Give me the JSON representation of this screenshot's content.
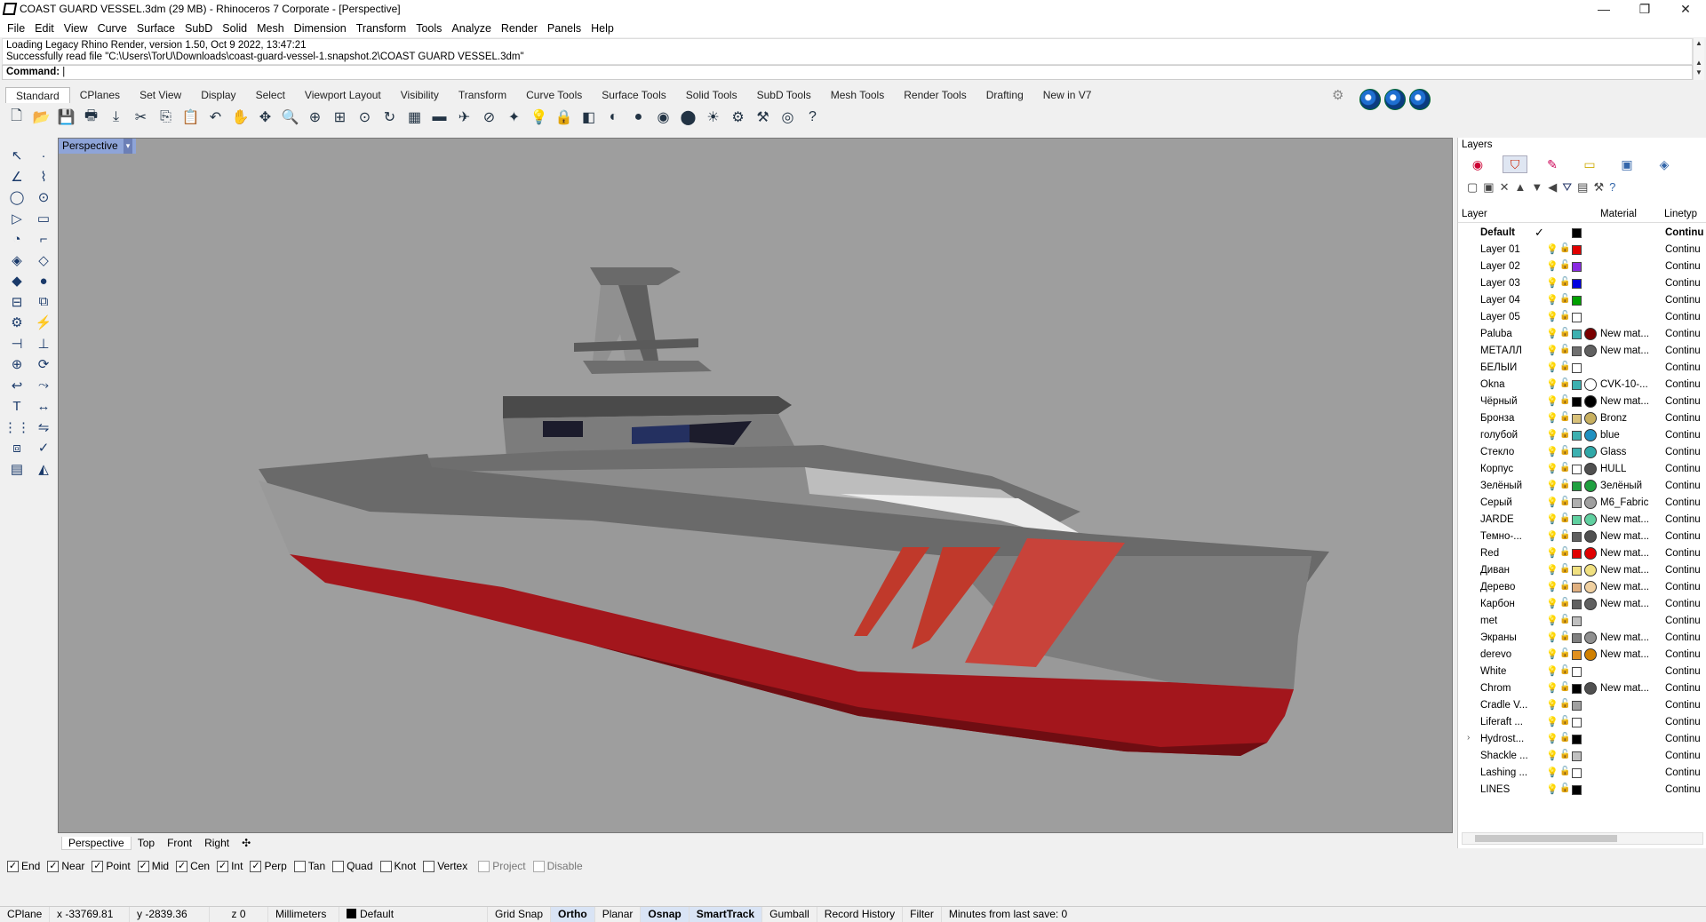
{
  "window": {
    "title": "COAST GUARD VESSEL.3dm (29 MB) - Rhinoceros 7 Corporate - [Perspective]",
    "minimize": "—",
    "maximize": "❐",
    "close": "✕"
  },
  "menu": [
    "File",
    "Edit",
    "View",
    "Curve",
    "Surface",
    "SubD",
    "Solid",
    "Mesh",
    "Dimension",
    "Transform",
    "Tools",
    "Analyze",
    "Render",
    "Panels",
    "Help"
  ],
  "history": {
    "line1": "Loading Legacy Rhino Render, version 1.50, Oct  9 2022, 13:47:21",
    "line2": "Successfully read file \"C:\\Users\\TorU\\Downloads\\coast-guard-vessel-1.snapshot.2\\COAST GUARD VESSEL.3dm\"",
    "command_label": "Command:"
  },
  "toolbar_tabs": [
    "Standard",
    "CPlanes",
    "Set View",
    "Display",
    "Select",
    "Viewport Layout",
    "Visibility",
    "Transform",
    "Curve Tools",
    "Surface Tools",
    "Solid Tools",
    "SubD Tools",
    "Mesh Tools",
    "Render Tools",
    "Drafting",
    "New in V7"
  ],
  "toolbar_icons": [
    "new-file-icon",
    "open-file-icon",
    "save-icon",
    "print-icon",
    "import-icon",
    "cut-icon",
    "copy-icon",
    "paste-icon",
    "undo-icon",
    "pan-hand-icon",
    "move-icon",
    "zoom-icon",
    "zoom-window-icon",
    "zoom-extents-icon",
    "zoom-selected-icon",
    "rotate-view-icon",
    "grid-icon",
    "car-icon",
    "plane-icon",
    "cplane-icon",
    "snap-icon",
    "light-icon",
    "lock-icon",
    "layer-icon",
    "color-wheel-icon",
    "shaded-sphere-icon",
    "rendered-sphere-icon",
    "blue-sphere-icon",
    "sun-icon",
    "settings-gear-icon",
    "options-icon",
    "rhino-render-icon",
    "help-icon"
  ],
  "viewport": {
    "label": "Perspective",
    "dropdown": "▾"
  },
  "viewport_tabs": [
    "Perspective",
    "Top",
    "Front",
    "Right",
    "✣"
  ],
  "osnaps": [
    {
      "label": "End",
      "checked": true
    },
    {
      "label": "Near",
      "checked": true
    },
    {
      "label": "Point",
      "checked": true
    },
    {
      "label": "Mid",
      "checked": true
    },
    {
      "label": "Cen",
      "checked": true
    },
    {
      "label": "Int",
      "checked": true
    },
    {
      "label": "Perp",
      "checked": true
    },
    {
      "label": "Tan",
      "checked": false
    },
    {
      "label": "Quad",
      "checked": false
    },
    {
      "label": "Knot",
      "checked": false
    },
    {
      "label": "Vertex",
      "checked": false
    },
    {
      "label": "Project",
      "checked": false
    },
    {
      "label": "Disable",
      "checked": false
    }
  ],
  "status": {
    "cplane": "CPlane",
    "x": "x -33769.81",
    "y": "y -2839.36",
    "z": "z 0",
    "units": "Millimeters",
    "layer": "Default",
    "grid_snap": "Grid Snap",
    "ortho": "Ortho",
    "planar": "Planar",
    "osnap": "Osnap",
    "smarttrack": "SmartTrack",
    "gumball": "Gumball",
    "record_history": "Record History",
    "filter": "Filter",
    "save": "Minutes from last save: 0"
  },
  "layers": {
    "title": "Layers",
    "col_layer": "Layer",
    "col_material": "Material",
    "col_linetype": "Linetyp",
    "rows": [
      {
        "name": "Default",
        "color": "#000000",
        "material": "",
        "mcolor": "",
        "linetype": "Continu",
        "current": "✓"
      },
      {
        "name": "Layer 01",
        "color": "#e00000",
        "material": "",
        "mcolor": "",
        "linetype": "Continu"
      },
      {
        "name": "Layer 02",
        "color": "#8a2be2",
        "material": "",
        "mcolor": "",
        "linetype": "Continu"
      },
      {
        "name": "Layer 03",
        "color": "#0000e0",
        "material": "",
        "mcolor": "",
        "linetype": "Continu"
      },
      {
        "name": "Layer 04",
        "color": "#00a000",
        "material": "",
        "mcolor": "",
        "linetype": "Continu"
      },
      {
        "name": "Layer 05",
        "color": "#ffffff",
        "material": "",
        "mcolor": "",
        "linetype": "Continu"
      },
      {
        "name": "Paluba",
        "color": "#3cb0b0",
        "material": "New mat...",
        "mcolor": "#7a0000",
        "linetype": "Continu"
      },
      {
        "name": "МЕТАЛЛ",
        "color": "#707070",
        "material": "New mat...",
        "mcolor": "#606060",
        "linetype": "Continu"
      },
      {
        "name": "БЕЛЫЙ",
        "color": "#ffffff",
        "material": "",
        "mcolor": "",
        "linetype": "Continu"
      },
      {
        "name": "Okna",
        "color": "#3cb0b0",
        "material": "CVK-10-...",
        "mcolor": "#ffffff",
        "linetype": "Continu"
      },
      {
        "name": "Чёрный",
        "color": "#000000",
        "material": "New mat...",
        "mcolor": "#000000",
        "linetype": "Continu"
      },
      {
        "name": "Бронза",
        "color": "#d9c27a",
        "material": "Bronz",
        "mcolor": "#c8b060",
        "linetype": "Continu"
      },
      {
        "name": "голубой",
        "color": "#3cb0b0",
        "material": "blue",
        "mcolor": "#2090c0",
        "linetype": "Continu"
      },
      {
        "name": "Стекло",
        "color": "#3cb0b0",
        "material": "Glass",
        "mcolor": "#30a8a8",
        "linetype": "Continu"
      },
      {
        "name": "Корпус",
        "color": "#ffffff",
        "material": "HULL",
        "mcolor": "#505050",
        "linetype": "Continu"
      },
      {
        "name": "Зелёный",
        "color": "#20a040",
        "material": "Зелёный",
        "mcolor": "#20a040",
        "linetype": "Continu"
      },
      {
        "name": "Серый",
        "color": "#b0b0b0",
        "material": "M6_Fabric",
        "mcolor": "#a0a0a0",
        "linetype": "Continu"
      },
      {
        "name": "JARDE",
        "color": "#60d0a0",
        "material": "New mat...",
        "mcolor": "#60d0a0",
        "linetype": "Continu"
      },
      {
        "name": "Темно-...",
        "color": "#606060",
        "material": "New mat...",
        "mcolor": "#505050",
        "linetype": "Continu"
      },
      {
        "name": "Red",
        "color": "#e00000",
        "material": "New mat...",
        "mcolor": "#e00000",
        "linetype": "Continu"
      },
      {
        "name": "Диван",
        "color": "#f0e080",
        "material": "New mat...",
        "mcolor": "#f0e080",
        "linetype": "Continu"
      },
      {
        "name": "Дерево",
        "color": "#e0b080",
        "material": "New mat...",
        "mcolor": "#f0d0a0",
        "linetype": "Continu"
      },
      {
        "name": "Карбон",
        "color": "#606060",
        "material": "New mat...",
        "mcolor": "#606060",
        "linetype": "Continu"
      },
      {
        "name": "met",
        "color": "#c0c0c0",
        "material": "",
        "mcolor": "",
        "linetype": "Continu"
      },
      {
        "name": "Экраны",
        "color": "#808080",
        "material": "New mat...",
        "mcolor": "#909090",
        "linetype": "Continu"
      },
      {
        "name": "derevo",
        "color": "#e09020",
        "material": "New mat...",
        "mcolor": "#d08000",
        "linetype": "Continu"
      },
      {
        "name": "White",
        "color": "#ffffff",
        "material": "",
        "mcolor": "",
        "linetype": "Continu"
      },
      {
        "name": "Chrom",
        "color": "#000000",
        "material": "New mat...",
        "mcolor": "#505050",
        "linetype": "Continu"
      },
      {
        "name": "Cradle V...",
        "color": "#a0a0a0",
        "material": "",
        "mcolor": "",
        "linetype": "Continu"
      },
      {
        "name": "Liferaft ...",
        "color": "#ffffff",
        "material": "",
        "mcolor": "",
        "linetype": "Continu"
      },
      {
        "name": "Hydrost...",
        "color": "#000000",
        "material": "",
        "mcolor": "",
        "linetype": "Continu",
        "expand": "›"
      },
      {
        "name": "Shackle ...",
        "color": "#c0c0c0",
        "material": "",
        "mcolor": "",
        "linetype": "Continu"
      },
      {
        "name": "Lashing ...",
        "color": "#ffffff",
        "material": "",
        "mcolor": "",
        "linetype": "Continu"
      },
      {
        "name": "LINES",
        "color": "#000000",
        "material": "",
        "mcolor": "",
        "linetype": "Continu"
      }
    ]
  }
}
